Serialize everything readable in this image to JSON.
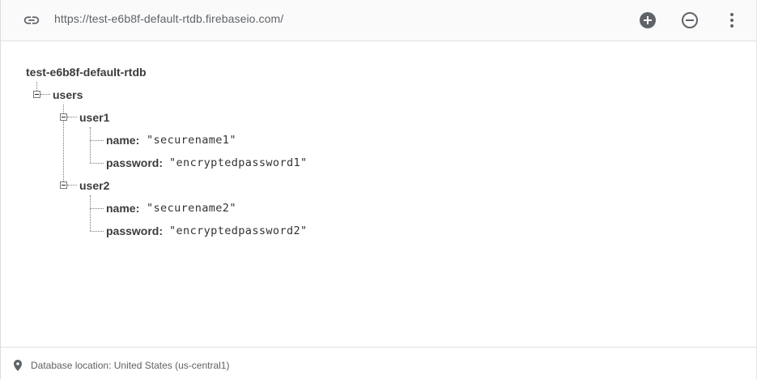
{
  "header": {
    "url": "https://test-e6b8f-default-rtdb.firebaseio.com/",
    "icons": {
      "link": "link-icon",
      "add": "add-circle-icon",
      "remove": "remove-circle-icon",
      "more": "more-vert-icon"
    }
  },
  "tree": {
    "root": "test-e6b8f-default-rtdb",
    "users_key": "users",
    "users": [
      {
        "key": "user1",
        "fields": [
          {
            "key": "name:",
            "value": "\"securename1\""
          },
          {
            "key": "password:",
            "value": "\"encryptedpassword1\""
          }
        ]
      },
      {
        "key": "user2",
        "fields": [
          {
            "key": "name:",
            "value": "\"securename2\""
          },
          {
            "key": "password:",
            "value": "\"encryptedpassword2\""
          }
        ]
      }
    ]
  },
  "footer": {
    "location_text": "Database location: United States (us-central1)",
    "icon": "location-pin-icon"
  },
  "colors": {
    "topbar_bg": "#fafafa",
    "icon": "#5f6368",
    "text": "#3c3c3c"
  }
}
